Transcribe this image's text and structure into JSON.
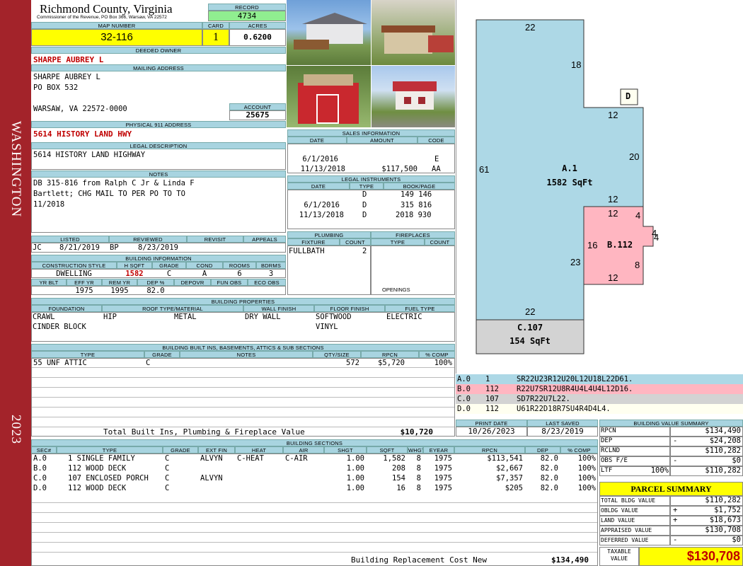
{
  "sidebar": {
    "district": "WASHINGTON",
    "year": "2023"
  },
  "header": {
    "county": "Richmond County, Virginia",
    "commissioner": "Commissioner of the Revenue, PO Box 366, Warsaw, VA 22572",
    "record_label": "RECORD",
    "record": "4734",
    "map_label": "MAP NUMBER",
    "map": "32-116",
    "card_label": "CARD",
    "card": "1",
    "acres_label": "ACRES",
    "acres": "0.6200"
  },
  "owner": {
    "deeded_label": "DEEDED OWNER",
    "deeded": "SHARPE AUBREY L",
    "mailing_label": "MAILING ADDRESS",
    "line1": "SHARPE AUBREY L",
    "line2": "PO BOX 532",
    "line3": "WARSAW, VA 22572-0000",
    "account_label": "ACCOUNT",
    "account": "25675",
    "physical_label": "PHYSICAL 911 ADDRESS",
    "physical": "5614 HISTORY LAND HWY",
    "legal_label": "LEGAL DESCRIPTION",
    "legal": "5614 HISTORY LAND HIGHWAY",
    "notes_label": "NOTES",
    "notes1": "DB 315-816 from Ralph C Jr & Linda F",
    "notes2": "Bartlett; CHG MAIL TO PER PO TO TO",
    "notes3": "11/2018"
  },
  "sales": {
    "label": "SALES INFORMATION",
    "h_date": "DATE",
    "h_amount": "AMOUNT",
    "h_code": "CODE",
    "rows": [
      {
        "date": "6/1/2016",
        "amount": "",
        "code": "E"
      },
      {
        "date": "11/13/2018",
        "amount": "$117,500",
        "code": "AA"
      }
    ]
  },
  "legal_inst": {
    "label": "LEGAL INSTRUMENTS",
    "h_date": "DATE",
    "h_type": "TYPE",
    "h_book": "BOOK/PAGE",
    "rows": [
      {
        "date": "",
        "type": "D",
        "book": "149 146"
      },
      {
        "date": "6/1/2016",
        "type": "D",
        "book": "315 816"
      },
      {
        "date": "11/13/2018",
        "type": "D",
        "book": "2018 930"
      }
    ]
  },
  "review": {
    "h_listed": "LISTED",
    "h_reviewed": "REVIEWED",
    "h_revisit": "REVISIT",
    "h_appeals": "APPEALS",
    "listed_by": "JC",
    "listed": "8/21/2019",
    "reviewed_by": "BP",
    "reviewed": "8/23/2019"
  },
  "plumbing": {
    "label": "PLUMBING",
    "h_fixture": "FIXTURE",
    "h_count": "COUNT",
    "fixture": "FULLBATH",
    "count": "2"
  },
  "fireplaces": {
    "label": "FIREPLACES",
    "h_type": "TYPE",
    "h_count": "COUNT",
    "openings": "OPENINGS"
  },
  "bldg_info": {
    "label": "BUILDING INFORMATION",
    "h_style": "CONSTRUCTION STYLE",
    "h_hsqft": "H SQFT",
    "h_grade": "GRADE",
    "h_cond": "COND",
    "h_rooms": "ROOMS",
    "h_bdrms": "BDRMS",
    "style": "DWELLING",
    "hsqft": "1582",
    "grade": "C",
    "cond": "A",
    "rooms": "6",
    "bdrms": "3",
    "h_yrblt": "YR BLT",
    "h_effyr": "EFF YR",
    "h_remyr": "REM YR",
    "h_dep": "DEP %",
    "h_depovr": "DEPOVR",
    "h_funobs": "FUN OBS",
    "h_ecoobs": "ECO OBS",
    "effyr": "1975",
    "remyr": "1995",
    "dep": "82.0"
  },
  "props": {
    "label": "BUILDING PROPERTIES",
    "h_found": "FOUNDATION",
    "h_roof": "ROOF TYPE/MATERIAL",
    "h_wall": "WALL FINISH",
    "h_floor": "FLOOR FINISH",
    "h_fuel": "FUEL TYPE",
    "found1": "CRAWL",
    "found2": "CINDER BLOCK",
    "roof1": "HIP",
    "roof2": "METAL",
    "wall": "DRY WALL",
    "floor1": "SOFTWOOD",
    "floor2": "VINYL",
    "fuel": "ELECTRIC"
  },
  "builtins": {
    "label": "BUILDING BUILT INS, BASEMENTS, ATTICS & SUB SECTIONS",
    "h_type": "TYPE",
    "h_grade": "GRADE",
    "h_notes": "NOTES",
    "h_qty": "QTY/SIZE",
    "h_rpcn": "RPCN",
    "h_comp": "% COMP",
    "type": "55 UNF ATTIC",
    "grade": "C",
    "qty": "572",
    "rpcn": "$5,720",
    "comp": "100%",
    "total_label": "Total Built Ins, Plumbing & Fireplace Value",
    "total": "$10,720"
  },
  "sketch": {
    "title_a": "A.1",
    "area_a": "1582 SqFt",
    "title_b": "B.112",
    "title_c": "C.107",
    "area_c": "154 SqFt",
    "d": "D",
    "dims": {
      "d22t": "22",
      "d18": "18",
      "d12a": "12",
      "d20": "20",
      "d12b": "12",
      "d61": "61",
      "d12c": "12",
      "d4a": "4",
      "d4b": "4",
      "d4c": "4",
      "d16": "16",
      "d23": "23",
      "d8": "8",
      "d12d": "12",
      "d22b": "22"
    }
  },
  "legend": [
    {
      "id": "A.0",
      "n": "1",
      "code": "SR22U23R12U20L12U18L22D61.",
      "color": "#add8e6"
    },
    {
      "id": "B.0",
      "n": "112",
      "code": "R22U7SR12U8R4U4L4U4L12D16.",
      "color": "#ffb6c1"
    },
    {
      "id": "C.0",
      "n": "107",
      "code": "SD7R22U7L22.",
      "color": "#d3d3d3"
    },
    {
      "id": "D.0",
      "n": "112",
      "code": "U61R22D18R7SU4R4D4L4.",
      "color": "#fffff0"
    }
  ],
  "print": {
    "h_print": "PRINT DATE",
    "h_saved": "LAST SAVED",
    "print": "10/26/2023",
    "saved": "8/23/2019"
  },
  "sections": {
    "label": "BUILDING SECTIONS",
    "h": [
      "SEC#",
      "TYPE",
      "GRADE",
      "EXT FIN",
      "HEAT",
      "AIR",
      "SHGT",
      "SQFT",
      "WHGT",
      "EYEAR",
      "RPCN",
      "DEP",
      "% COMP"
    ],
    "rows": [
      [
        "A.0",
        "1 SINGLE FAMILY",
        "C",
        "ALVYN",
        "C-HEAT",
        "C-AIR",
        "1.00",
        "1,582",
        "8",
        "1975",
        "$113,541",
        "82.0",
        "100%"
      ],
      [
        "B.0",
        "112 WOOD DECK",
        "C",
        "",
        "",
        "",
        "1.00",
        "208",
        "8",
        "1975",
        "$2,667",
        "82.0",
        "100%"
      ],
      [
        "C.0",
        "107 ENCLOSED PORCH",
        "C",
        "ALVYN",
        "",
        "",
        "1.00",
        "154",
        "8",
        "1975",
        "$7,357",
        "82.0",
        "100%"
      ],
      [
        "D.0",
        "112 WOOD DECK",
        "C",
        "",
        "",
        "",
        "1.00",
        "16",
        "8",
        "1975",
        "$205",
        "82.0",
        "100%"
      ]
    ],
    "total_label": "Building Replacement Cost New",
    "total": "$134,490"
  },
  "bvs": {
    "label": "BUILDING VALUE SUMMARY",
    "rpcn_l": "RPCN",
    "rpcn": "$134,490",
    "dep_l": "DEP",
    "dep_s": "-",
    "dep": "$24,208",
    "rclnd_l": "RCLND",
    "rclnd": "$110,282",
    "obs_l": "OBS F/E",
    "obs_s": "-",
    "obs": "$0",
    "ltf_l": "LTF",
    "ltf_p": "100%",
    "ltf": "$110,282"
  },
  "parcel": {
    "label": "PARCEL SUMMARY",
    "bldg_l": "TOTAL BLDG VALUE",
    "bldg": "$110,282",
    "obldg_l": "OBLDG VALUE",
    "obldg_s": "+",
    "obldg": "$1,752",
    "land_l": "LAND VALUE",
    "land_s": "+",
    "land": "$18,673",
    "appr_l": "APPRAISED VALUE",
    "appr": "$130,708",
    "def_l": "DEFERRED VALUE",
    "def_s": "-",
    "def": "$0",
    "tax_l1": "TAXABLE",
    "tax_l2": "VALUE",
    "tax": "$130,708"
  }
}
